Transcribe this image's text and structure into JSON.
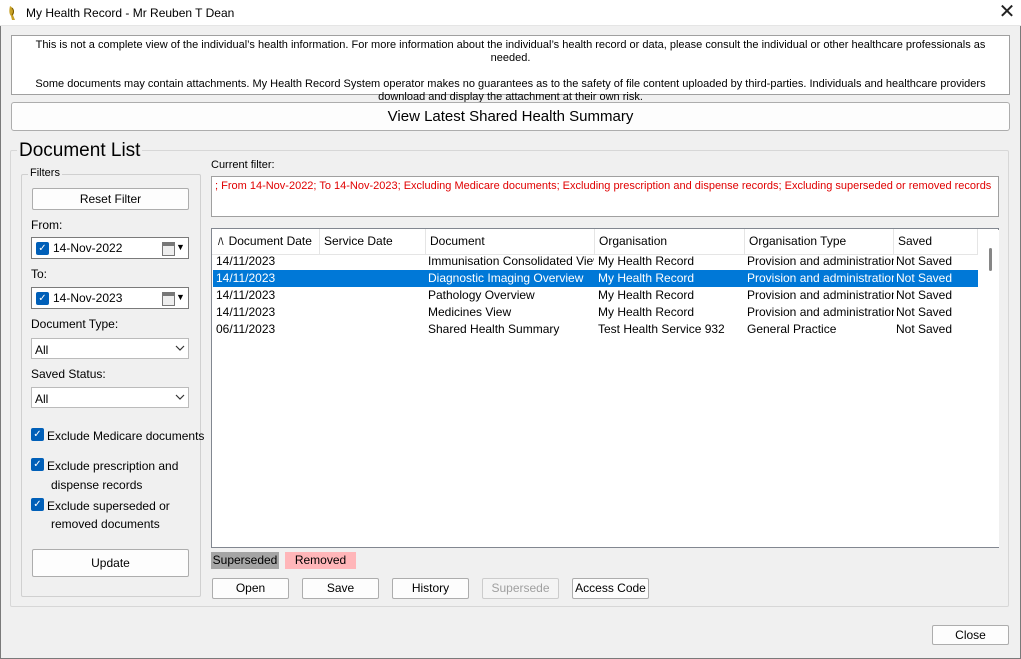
{
  "window": {
    "title": "My Health Record - Mr Reuben T Dean",
    "close_glyph": "✕"
  },
  "disclaimer": {
    "line1": "This is not a complete view of the individual’s health information. For more information about the individual’s health record or data, please consult the individual or other healthcare professionals as needed.",
    "line2": "Some documents may contain attachments. My Health Record System operator makes no guarantees as to the safety of file content uploaded by third-parties. Individuals and healthcare providers download and display the attachment at their own risk."
  },
  "summary_button": "View Latest Shared Health Summary",
  "document_list": {
    "title": "Document List",
    "current_filter_label": "Current filter:",
    "current_filter_text": "; From 14-Nov-2022; To 14-Nov-2023; Excluding Medicare documents; Excluding prescription and dispense records; Excluding superseded or removed records"
  },
  "filters": {
    "title": "Filters",
    "reset_label": "Reset Filter",
    "from_label": "From:",
    "from_value": "14-Nov-2022",
    "to_label": "To:",
    "to_value": "14-Nov-2023",
    "document_type_label": "Document Type:",
    "document_type_value": "All",
    "saved_status_label": "Saved Status:",
    "saved_status_value": "All",
    "exclude_medicare": "Exclude Medicare documents",
    "exclude_prescription_1": "Exclude prescription and",
    "exclude_prescription_2": "dispense records",
    "exclude_superseded_1": "Exclude superseded or",
    "exclude_superseded_2": "removed documents",
    "update_label": "Update",
    "check_glyph": "✓",
    "sort_glyph": "/\\"
  },
  "table": {
    "columns": [
      "Document Date",
      "Service Date",
      "Document",
      "Organisation",
      "Organisation Type",
      "Saved"
    ],
    "rows": [
      {
        "document_date": "14/11/2023",
        "service_date": "",
        "document": "Immunisation Consolidated View",
        "organisation": "My Health Record",
        "organisation_type": "Provision and administration of pu",
        "saved": "Not Saved"
      },
      {
        "document_date": "14/11/2023",
        "service_date": "",
        "document": "Diagnostic Imaging Overview",
        "organisation": "My Health Record",
        "organisation_type": "Provision and administration of pu",
        "saved": "Not Saved"
      },
      {
        "document_date": "14/11/2023",
        "service_date": "",
        "document": "Pathology Overview",
        "organisation": "My Health Record",
        "organisation_type": "Provision and administration of pu",
        "saved": "Not Saved"
      },
      {
        "document_date": "14/11/2023",
        "service_date": "",
        "document": "Medicines View",
        "organisation": "My Health Record",
        "organisation_type": "Provision and administration of pu",
        "saved": "Not Saved"
      },
      {
        "document_date": "06/11/2023",
        "service_date": "",
        "document": "Shared Health Summary",
        "organisation": "Test Health Service 932",
        "organisation_type": "General Practice",
        "saved": "Not Saved"
      }
    ]
  },
  "legend": {
    "superseded": "Superseded",
    "removed": "Removed"
  },
  "actions": {
    "open": "Open",
    "save": "Save",
    "history": "History",
    "supersede": "Supersede",
    "access_code": "Access Code",
    "close": "Close"
  },
  "colors": {
    "selection": "#0078d7",
    "filter_text": "#e00000",
    "checkbox": "#005fb8",
    "superseded": "#a5a5a5",
    "removed": "#ffb6b9"
  }
}
